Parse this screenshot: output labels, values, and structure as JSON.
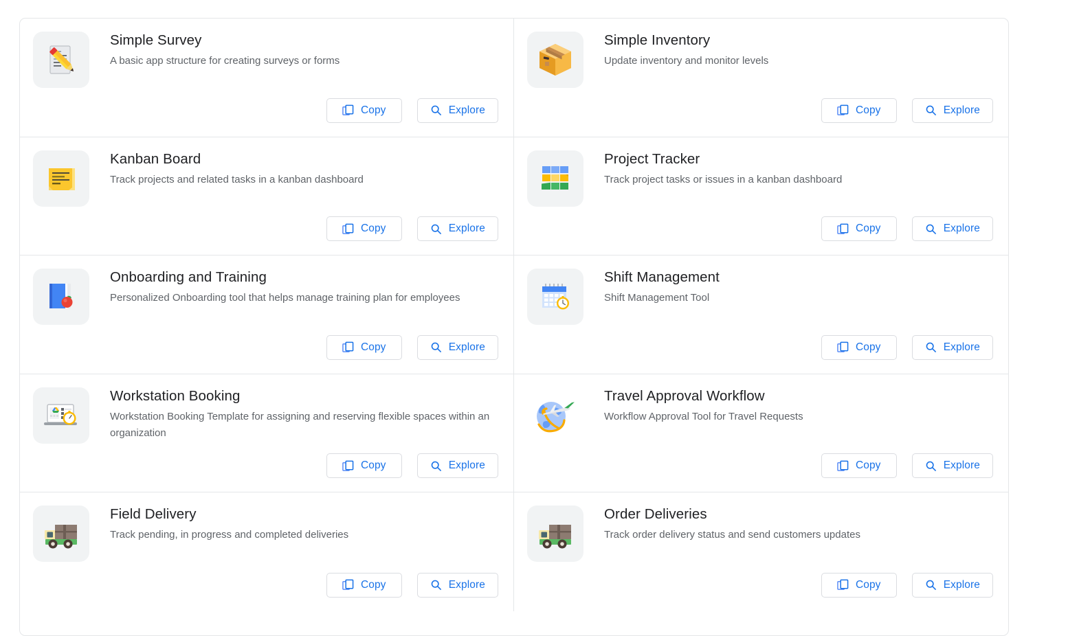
{
  "buttons": {
    "copy_label": "Copy",
    "explore_label": "Explore",
    "copy_icon": "copy-icon",
    "explore_icon": "search-icon"
  },
  "colors": {
    "accent": "#1a73e8",
    "title_text": "#202124",
    "desc_text": "#5f6368",
    "border": "#e4e6e8",
    "icon_tile_bg": "#f1f3f4"
  },
  "rows": [
    {
      "left": {
        "title": "Simple Survey",
        "description": "A basic app structure for creating surveys or forms",
        "icon": "survey-pencil-icon"
      },
      "right": {
        "title": "Simple Inventory",
        "description": "Update inventory and monitor levels",
        "icon": "package-box-icon"
      }
    },
    {
      "left": {
        "title": "Kanban Board",
        "description": "Track projects and related tasks in a kanban dashboard",
        "icon": "sticky-note-icon"
      },
      "right": {
        "title": "Project Tracker",
        "description": "Track project tasks or issues in a kanban dashboard",
        "icon": "kanban-grid-icon"
      }
    },
    {
      "left": {
        "title": "Onboarding and Training",
        "description": "Personalized Onboarding tool that helps manage training plan for employees",
        "icon": "book-apple-icon"
      },
      "right": {
        "title": "Shift Management",
        "description": "Shift Management Tool",
        "icon": "calendar-clock-icon"
      }
    },
    {
      "left": {
        "title": "Workstation Booking",
        "description": "Workstation Booking Template for assigning and reserving flexible spaces within an organization",
        "icon": "laptop-stopwatch-icon"
      },
      "right": {
        "title": "Travel Approval Workflow",
        "description": "Workflow Approval Tool for Travel Requests",
        "icon": "globe-plane-icon"
      }
    },
    {
      "left": {
        "title": "Field Delivery",
        "description": "Track pending, in progress and completed deliveries",
        "icon": "delivery-truck-icon"
      },
      "right": {
        "title": "Order Deliveries",
        "description": "Track order delivery status and send customers updates",
        "icon": "delivery-truck-icon"
      }
    }
  ]
}
